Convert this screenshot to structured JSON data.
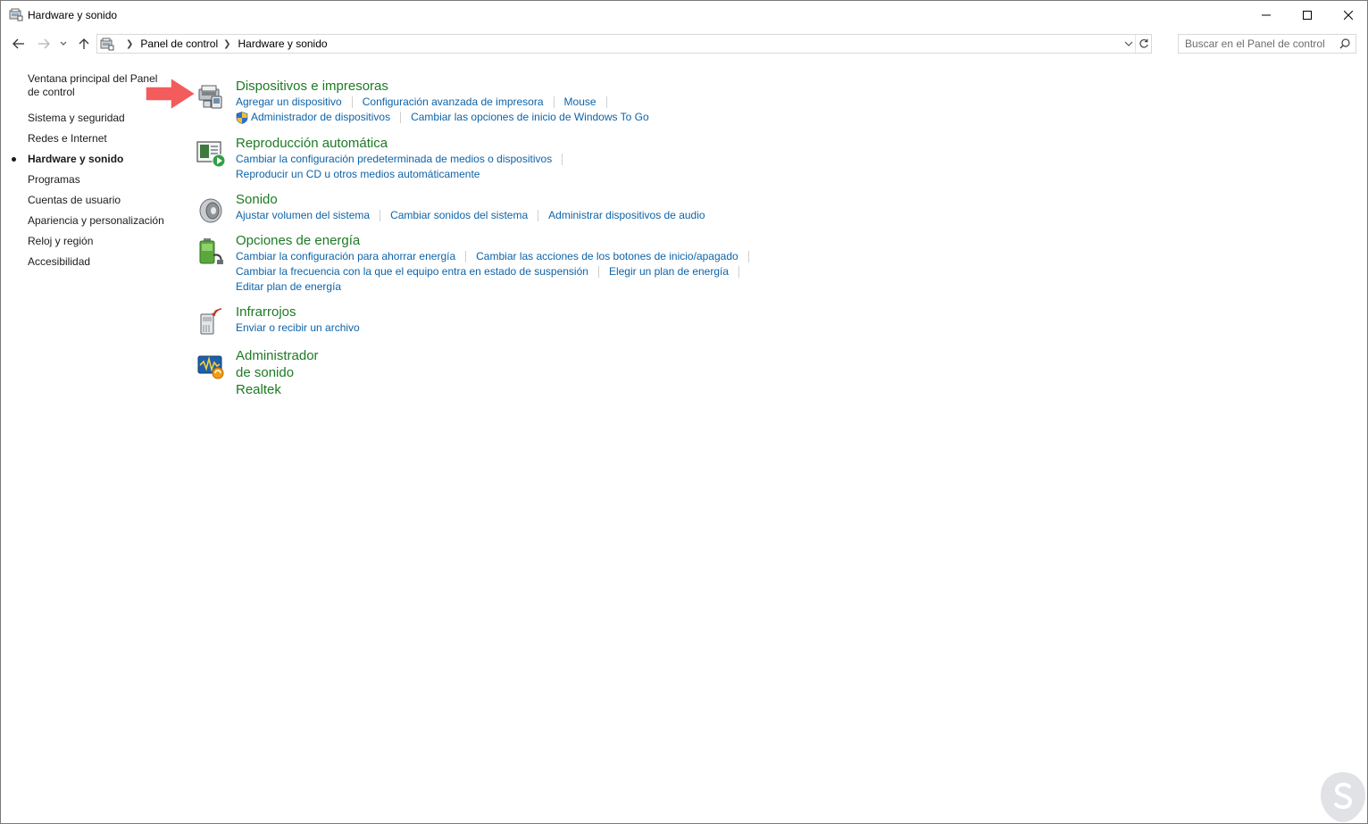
{
  "window": {
    "title": "Hardware y sonido",
    "icon": "control-panel-icon"
  },
  "controls": {
    "minimize": "minimize-icon",
    "maximize": "maximize-icon",
    "close": "close-icon"
  },
  "nav": {
    "back": "back-arrow-icon",
    "forward": "forward-arrow-icon",
    "recent": "chevron-down-icon",
    "up": "up-arrow-icon"
  },
  "address": {
    "crumbs": [
      "Panel de control",
      "Hardware y sonido"
    ],
    "refresh": "refresh-icon"
  },
  "search": {
    "placeholder": "Buscar en el Panel de control"
  },
  "sidebar": {
    "home": "Ventana principal del Panel de control",
    "items": [
      {
        "label": "Sistema y seguridad",
        "active": false
      },
      {
        "label": "Redes e Internet",
        "active": false
      },
      {
        "label": "Hardware y sonido",
        "active": true
      },
      {
        "label": "Programas",
        "active": false
      },
      {
        "label": "Cuentas de usuario",
        "active": false
      },
      {
        "label": "Apariencia y personalización",
        "active": false
      },
      {
        "label": "Reloj y región",
        "active": false
      },
      {
        "label": "Accesibilidad",
        "active": false
      }
    ]
  },
  "categories": [
    {
      "title": "Dispositivos e impresoras",
      "icon": "devices-printers-icon",
      "links": [
        [
          "Agregar un dispositivo",
          "Configuración avanzada de impresora",
          "Mouse"
        ],
        [
          "Administrador de dispositivos",
          "Cambiar las opciones de inicio de Windows To Go"
        ]
      ]
    },
    {
      "title": "Reproducción automática",
      "icon": "autoplay-icon",
      "links": [
        [
          "Cambiar la configuración predeterminada de medios o dispositivos"
        ],
        [
          "Reproducir un CD u otros medios automáticamente"
        ]
      ]
    },
    {
      "title": "Sonido",
      "icon": "speaker-icon",
      "links": [
        [
          "Ajustar volumen del sistema",
          "Cambiar sonidos del sistema",
          "Administrar dispositivos de audio"
        ]
      ]
    },
    {
      "title": "Opciones de energía",
      "icon": "power-options-icon",
      "links": [
        [
          "Cambiar la configuración para ahorrar energía",
          "Cambiar las acciones de los botones de inicio/apagado"
        ],
        [
          "Cambiar la frecuencia con la que el equipo entra en estado de suspensión",
          "Elegir un plan de energía"
        ],
        [
          "Editar plan de energía"
        ]
      ]
    },
    {
      "title": "Infrarrojos",
      "icon": "infrared-icon",
      "links": [
        [
          "Enviar o recibir un archivo"
        ]
      ]
    },
    {
      "title": "Administrador de sonido Realtek",
      "icon": "realtek-audio-icon",
      "links": []
    }
  ],
  "colors": {
    "category_title": "#1d7a24",
    "link": "#0d63a8",
    "arrow": "#f25c5c",
    "shield": "#2b6fd1"
  }
}
